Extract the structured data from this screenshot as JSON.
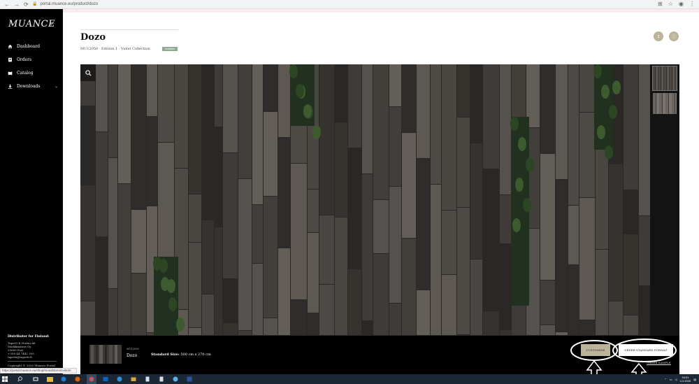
{
  "browser": {
    "url": "portal.muance.eu/product/dozo",
    "nav": [
      "←",
      "→",
      "⟳"
    ],
    "right_icons": [
      "translate-icon",
      "star-icon",
      "account-icon",
      "menu-icon"
    ]
  },
  "sidebar": {
    "logo": "MUANCE",
    "collapse_icon": "‹",
    "items": [
      {
        "label": "Dashboard",
        "icon": "home-icon"
      },
      {
        "label": "Orders",
        "icon": "orders-icon"
      },
      {
        "label": "Catalog",
        "icon": "catalog-icon"
      },
      {
        "label": "Downloads",
        "icon": "download-icon",
        "chevron": "⌄"
      }
    ],
    "distributor": {
      "title": "Distributor for Finland:",
      "lines": [
        "TapetU.K.Nurmi Ab",
        "Markkinatori Oy",
        "29600 Pori",
        "+358 44 7442 393",
        "tapetti@tapetti.fi"
      ],
      "copyright": "Copyright © 2020 Muance Portal"
    }
  },
  "status_url": "https://portal.muance.eu/shop/mood/dozo/custom",
  "product": {
    "title": "Dozo",
    "subtitle": "MU12050 · Edition 1 · Violet Collection",
    "badge": "Available",
    "download_icon": "↥",
    "info_icon": "ⓘ"
  },
  "bottom_bar": {
    "code": "MU12050",
    "name": "Dozo",
    "size_label": "Standard Size:",
    "size_value": "500 cm x 270 cm",
    "customize_label": "CUSTOMIZE",
    "order_label": "ORDER STANDARD FORMAT",
    "sample_label": "ORDER SAMPLE"
  },
  "taskbar": {
    "time": "16:01",
    "date": "4.3.2020"
  },
  "colors": {
    "accent": "#bcb39a",
    "badge": "#8fa98f",
    "sidebar": "#000000"
  }
}
